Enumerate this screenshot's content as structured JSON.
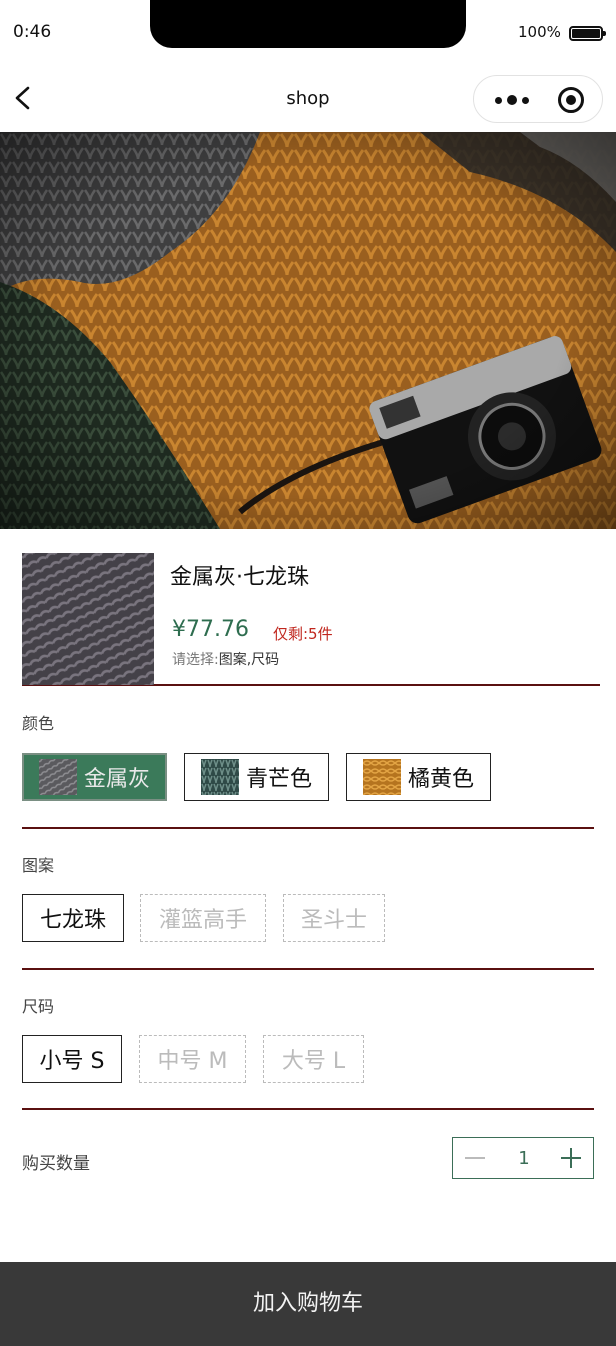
{
  "status_bar": {
    "time": "0:46",
    "battery": "100%"
  },
  "nav": {
    "title": "shop"
  },
  "product": {
    "name": "金属灰·七龙珠",
    "price": "¥77.76",
    "stock": "仅剩:5件",
    "hint_prefix": "请选择:",
    "hint_items": "图案,尺码"
  },
  "color": {
    "title": "颜色",
    "options": [
      {
        "label": "金属灰",
        "state": "selected",
        "swatch": "#6b6b6e"
      },
      {
        "label": "青芒色",
        "state": "normal",
        "swatch": "#4d6b66"
      },
      {
        "label": "橘黄色",
        "state": "normal",
        "swatch": "#c98a2a"
      }
    ]
  },
  "pattern": {
    "title": "图案",
    "options": [
      {
        "label": "七龙珠",
        "state": "normal"
      },
      {
        "label": "灌篮高手",
        "state": "disabled"
      },
      {
        "label": "圣斗士",
        "state": "disabled"
      }
    ]
  },
  "size": {
    "title": "尺码",
    "options": [
      {
        "label": "小号 S",
        "state": "normal"
      },
      {
        "label": "中号 M",
        "state": "disabled"
      },
      {
        "label": "大号 L",
        "state": "disabled"
      }
    ]
  },
  "quantity": {
    "label": "购买数量",
    "value": "1"
  },
  "cart_button": {
    "label": "加入购物车"
  },
  "colors": {
    "accent": "#3b7a5a",
    "price": "#2e6d4f",
    "stock": "#c0261d",
    "divider": "#5a1010",
    "bottom_bar": "#393939"
  }
}
